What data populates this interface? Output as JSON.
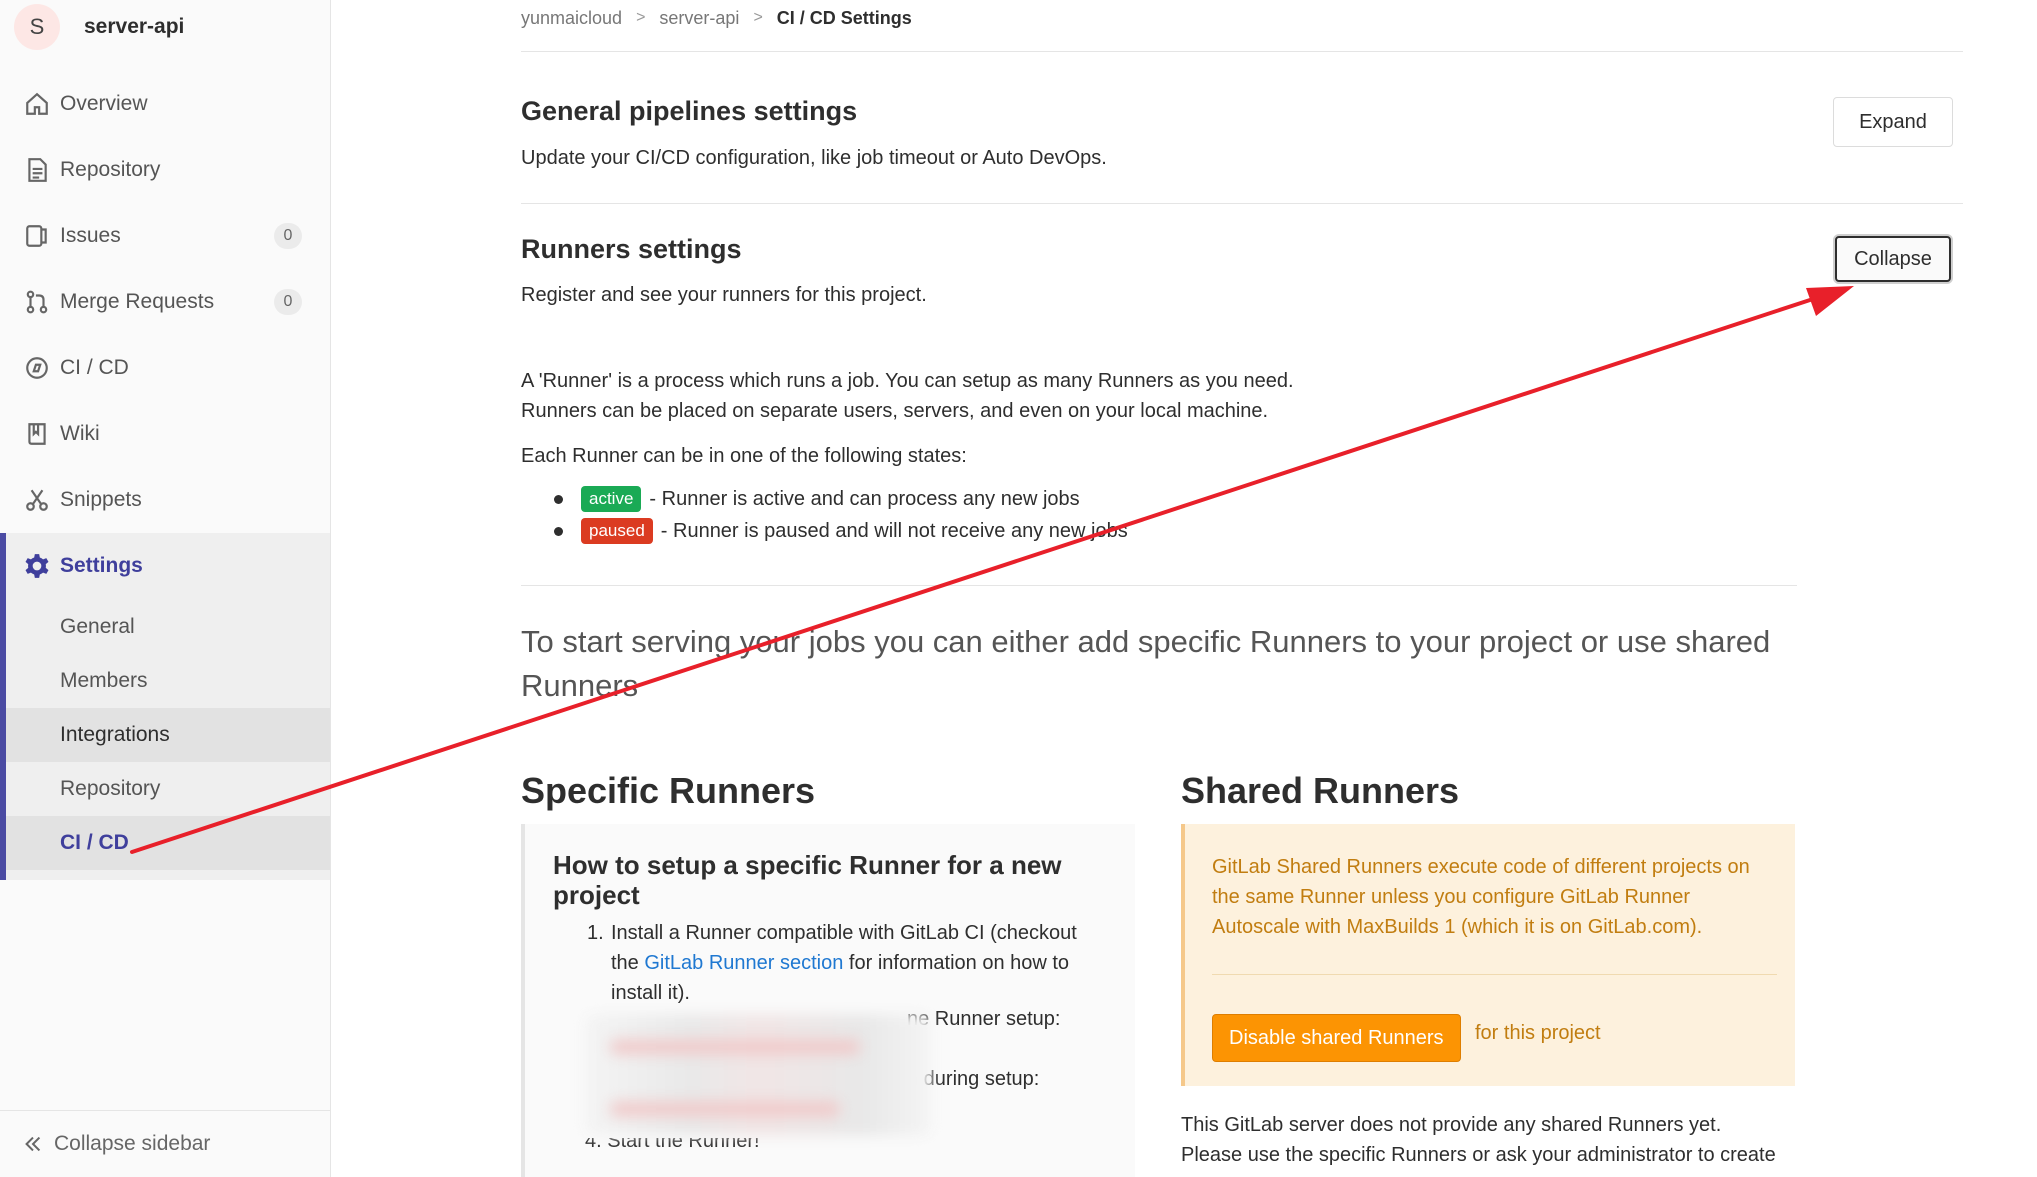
{
  "project": {
    "avatar_letter": "S",
    "name": "server-api"
  },
  "sidebar": {
    "items": [
      {
        "label": "Overview",
        "icon": "home-icon"
      },
      {
        "label": "Repository",
        "icon": "document-icon"
      },
      {
        "label": "Issues",
        "icon": "issues-icon",
        "count": "0"
      },
      {
        "label": "Merge Requests",
        "icon": "merge-request-icon",
        "count": "0"
      },
      {
        "label": "CI / CD",
        "icon": "rocket-icon"
      },
      {
        "label": "Wiki",
        "icon": "book-icon"
      },
      {
        "label": "Snippets",
        "icon": "scissors-icon"
      }
    ],
    "settings": {
      "label": "Settings",
      "icon": "gear-icon",
      "subitems": [
        {
          "label": "General"
        },
        {
          "label": "Members"
        },
        {
          "label": "Integrations"
        },
        {
          "label": "Repository"
        },
        {
          "label": "CI / CD"
        }
      ]
    },
    "collapse_label": "Collapse sidebar"
  },
  "breadcrumb": {
    "group": "yunmaicloud",
    "project": "server-api",
    "current": "CI / CD Settings"
  },
  "general_pipelines": {
    "title": "General pipelines settings",
    "description": "Update your CI/CD configuration, like job timeout or Auto DevOps.",
    "button": "Expand"
  },
  "runners": {
    "title": "Runners settings",
    "description": "Register and see your runners for this project.",
    "button": "Collapse",
    "intro_line1": "A 'Runner' is a process which runs a job. You can setup as many Runners as you need.",
    "intro_line2": "Runners can be placed on separate users, servers, and even on your local machine.",
    "states_intro": "Each Runner can be in one of the following states:",
    "states": [
      {
        "tag": "active",
        "text": "- Runner is active and can process any new jobs"
      },
      {
        "tag": "paused",
        "text": "- Runner is paused and will not receive any new jobs"
      }
    ],
    "lead": "To start serving your jobs you can either add specific Runners to your project or use shared Runners"
  },
  "specific": {
    "title": "Specific Runners",
    "box_title": "How to setup a specific Runner for a new project",
    "step1_a": "Install a Runner compatible with GitLab CI (checkout the ",
    "step1_link": "GitLab Runner section",
    "step1_b": " for information on how to install it).",
    "step2_tail": "ne Runner setup:",
    "step3_tail": "n during setup:",
    "step4": "4. Start the Runner!",
    "step1_num": "1."
  },
  "shared": {
    "title": "Shared Runners",
    "warning": "GitLab Shared Runners execute code of different projects on the same Runner unless you configure GitLab Runner Autoscale with MaxBuilds 1 (which it is on GitLab.com).",
    "button": "Disable shared Runners",
    "button_suffix": "for this project",
    "note_line1": "This GitLab server does not provide any shared Runners yet.",
    "note_line2": "Please use the specific Runners or ask your administrator to create"
  },
  "colors": {
    "accent": "#3f3f9c",
    "active_tag": "#1aaa55",
    "paused_tag": "#db3b21",
    "warning_button": "#fc9403",
    "annotation_arrow": "#e8202a"
  }
}
